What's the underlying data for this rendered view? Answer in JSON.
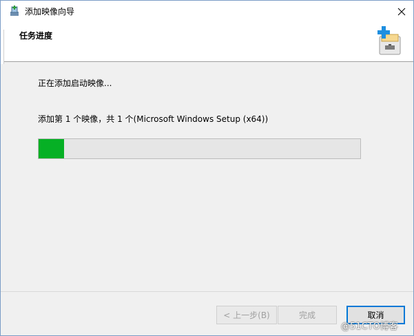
{
  "window": {
    "title": "添加映像向导",
    "close_icon": "close-icon"
  },
  "header": {
    "title": "任务进度"
  },
  "content": {
    "status": "正在添加启动映像...",
    "detail": "添加第 1 个映像，共 1 个(Microsoft Windows Setup (x64))",
    "progress_percent": 8
  },
  "buttons": {
    "back": "< 上一步(B)",
    "finish": "完成",
    "cancel": "取消"
  },
  "watermark": "@51CTO博客",
  "colors": {
    "progress_fill": "#06b025",
    "accent": "#0078d7"
  }
}
